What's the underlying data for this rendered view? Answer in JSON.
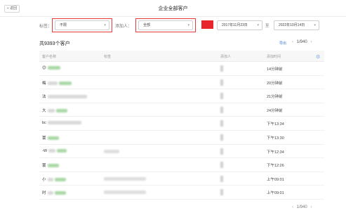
{
  "header": {
    "back_label": "« 返回",
    "title": "企业全部客户"
  },
  "filters": {
    "tag_label": "标签：",
    "tag_value": "不限",
    "adder_label": "添加人：",
    "adder_value": "全部",
    "highlight_color": "#e8242d",
    "date_from": "2017年11月23日",
    "date_sep": "至",
    "date_to": "2022年10月14日"
  },
  "summary": {
    "total_text": "共9393个客户",
    "export_label": "导出",
    "page_text": "1/940"
  },
  "table": {
    "columns": [
      "客户名称",
      "标签",
      "添加人",
      "添加时间"
    ],
    "rows": [
      {
        "prefix": "😊",
        "time": "14分钟前"
      },
      {
        "prefix": "梅",
        "time": "20分钟前"
      },
      {
        "prefix": "法",
        "time": "21分钟前"
      },
      {
        "prefix": "大",
        "time": "24分钟前"
      },
      {
        "prefix": "bc",
        "time": "下午13:34"
      },
      {
        "prefix": "寰",
        "time": "下午13:30"
      },
      {
        "prefix": "-W",
        "time": "下午12:34"
      },
      {
        "prefix": "寰",
        "time": "下午12:26"
      },
      {
        "prefix": "小",
        "time": "上午09:01"
      },
      {
        "prefix": "时",
        "time": "上午09:01"
      }
    ]
  },
  "footer": {
    "page_text": "1/940"
  },
  "icons": {
    "back": "back-icon",
    "gear": "gear-icon",
    "prev": "chevron-left-icon",
    "next": "chevron-right-icon"
  }
}
